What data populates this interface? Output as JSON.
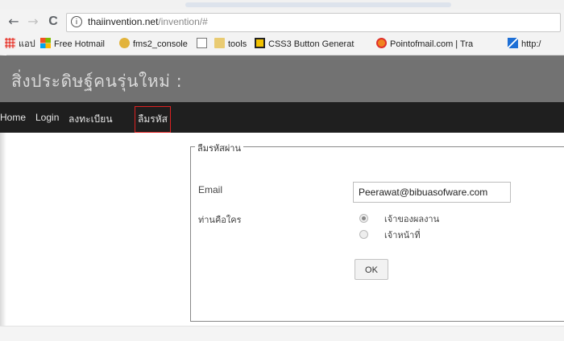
{
  "browser": {
    "back_glyph": "←",
    "forward_glyph": "→",
    "reload_glyph": "C",
    "info_glyph": "i",
    "url_host": "thaiinvention.net",
    "url_path": "/invention/#",
    "bookmarks": [
      {
        "label": "แอป",
        "icon": "apps-grid-icon",
        "color": "#e8453c"
      },
      {
        "label": "Free Hotmail",
        "icon": "windows-logo-icon",
        "color": "#f25022"
      },
      {
        "label": "fms2_console",
        "icon": "flash-media-icon",
        "color": "#d4a017"
      },
      {
        "label": "",
        "icon": "page-icon",
        "color": "#888888"
      },
      {
        "label": "tools",
        "icon": "folder-icon",
        "color": "#e3c46d"
      },
      {
        "label": "CSS3 Button Generat",
        "icon": "css3-icon",
        "color": "#f2c200"
      },
      {
        "label": "Pointofmail.com | Tra",
        "icon": "circle-logo-icon",
        "color": "#f0831e"
      },
      {
        "label": "http:/",
        "icon": "link-icon",
        "color": "#1d6fd6"
      }
    ]
  },
  "site": {
    "title": "สิ่งประดิษฐ์คนรุ่นใหม่ :",
    "nav": {
      "home": "Home",
      "login": "Login",
      "register": "ลงทะเบียน",
      "forgot": "ลืมรหัส"
    }
  },
  "form": {
    "legend": "ลืมรหัสผ่าน",
    "email_label": "Email",
    "email_value": "Peerawat@bibuasofware.com",
    "who_label": "ท่านคือใคร",
    "options": [
      {
        "label": "เจ้าของผลงาน",
        "checked": true
      },
      {
        "label": "เจ้าหน้าที่",
        "checked": false
      }
    ],
    "submit_label": "OK"
  },
  "colors": {
    "header_bg": "#727272",
    "nav_bg": "#1f1f1f",
    "active_border": "#dd2222"
  }
}
